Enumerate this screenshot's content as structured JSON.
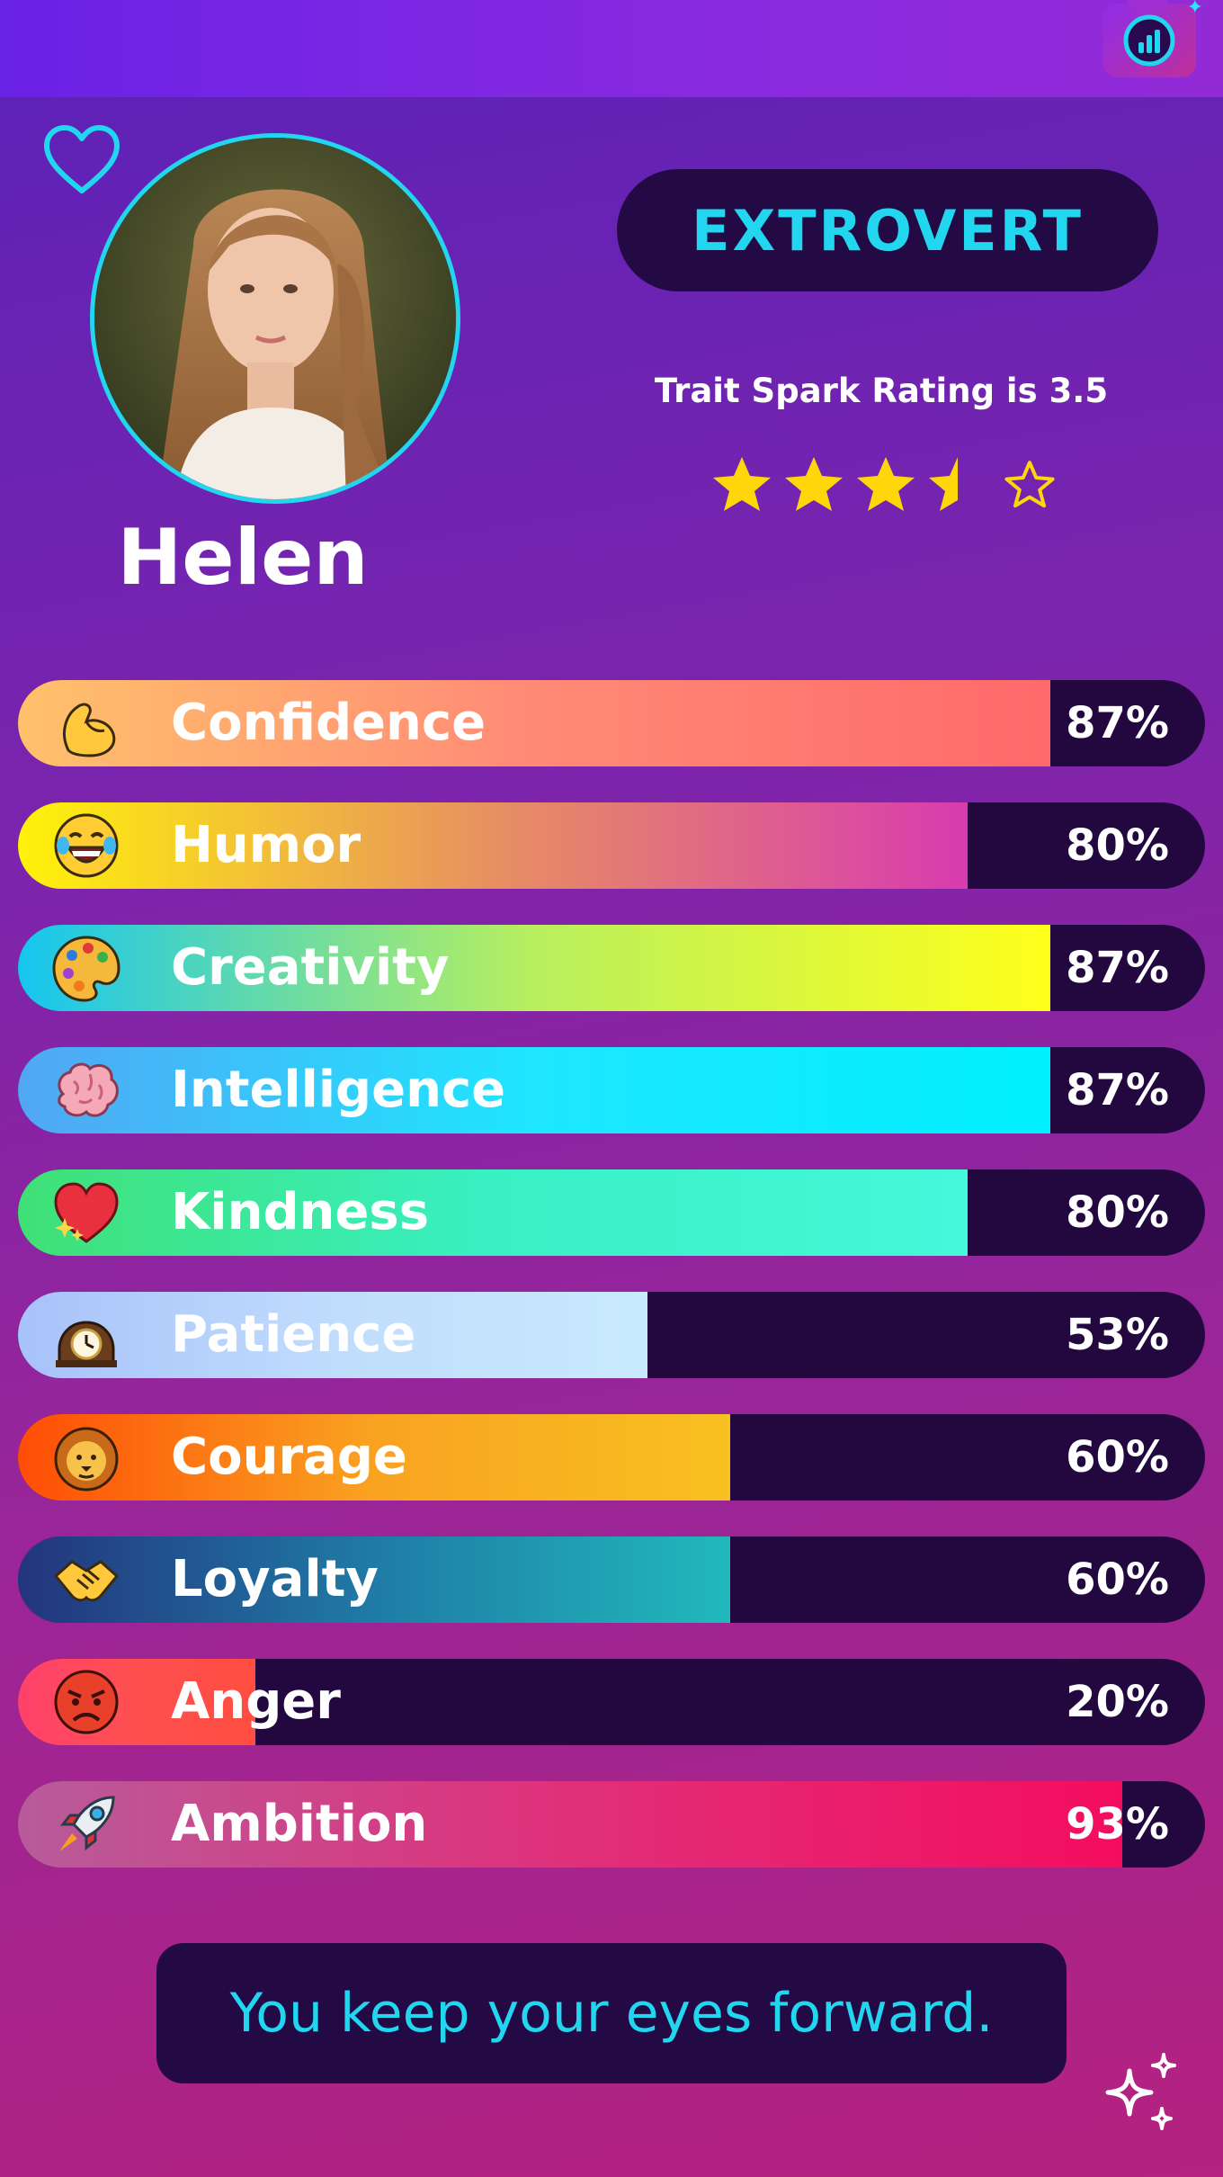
{
  "profile": {
    "name": "Helen",
    "personality_type": "EXTROVERT",
    "rating_text": "Trait Spark Rating is 3.5",
    "rating": 3.5,
    "rating_max": 5
  },
  "traits": [
    {
      "label": "Confidence",
      "value": 87,
      "value_text": "87%",
      "icon": "flexed-biceps-icon",
      "colors": [
        "#ffc16b",
        "#ff8a76",
        "#ff6a6a"
      ]
    },
    {
      "label": "Humor",
      "value": 80,
      "value_text": "80%",
      "icon": "tears-of-joy-icon",
      "colors": [
        "#fff20a",
        "#e79061",
        "#d83bb0"
      ]
    },
    {
      "label": "Creativity",
      "value": 87,
      "value_text": "87%",
      "icon": "artist-palette-icon",
      "colors": [
        "#16c6f0",
        "#b8ef5e",
        "#ffff1a"
      ]
    },
    {
      "label": "Intelligence",
      "value": 87,
      "value_text": "87%",
      "icon": "brain-icon",
      "colors": [
        "#52a6f4",
        "#1ee6ff",
        "#00f0ff"
      ]
    },
    {
      "label": "Kindness",
      "value": 80,
      "value_text": "80%",
      "icon": "sparkling-heart-icon",
      "colors": [
        "#3fe075",
        "#39f0c4",
        "#44f8da"
      ]
    },
    {
      "label": "Patience",
      "value": 53,
      "value_text": "53%",
      "icon": "mantelpiece-clock-icon",
      "colors": [
        "#a8c2fa",
        "#c0dcfc",
        "#c8eafd"
      ]
    },
    {
      "label": "Courage",
      "value": 60,
      "value_text": "60%",
      "icon": "lion-face-icon",
      "colors": [
        "#ff4d06",
        "#f9a321",
        "#f8c020"
      ]
    },
    {
      "label": "Loyalty",
      "value": 60,
      "value_text": "60%",
      "icon": "handshake-icon",
      "colors": [
        "#23357d",
        "#1f7ba6",
        "#20b9bc"
      ]
    },
    {
      "label": "Anger",
      "value": 20,
      "value_text": "20%",
      "icon": "angry-face-icon",
      "colors": [
        "#ff416c",
        "#ff5050",
        "#ff4d40"
      ]
    },
    {
      "label": "Ambition",
      "value": 93,
      "value_text": "93%",
      "icon": "rocket-icon",
      "colors": [
        "#b85b9a",
        "#e0307a",
        "#f40d5f"
      ]
    }
  ],
  "quote": "You keep your eyes forward.",
  "theme": {
    "accent": "#22d6f0",
    "panel": "#230a44",
    "star": "#ffd60a"
  }
}
